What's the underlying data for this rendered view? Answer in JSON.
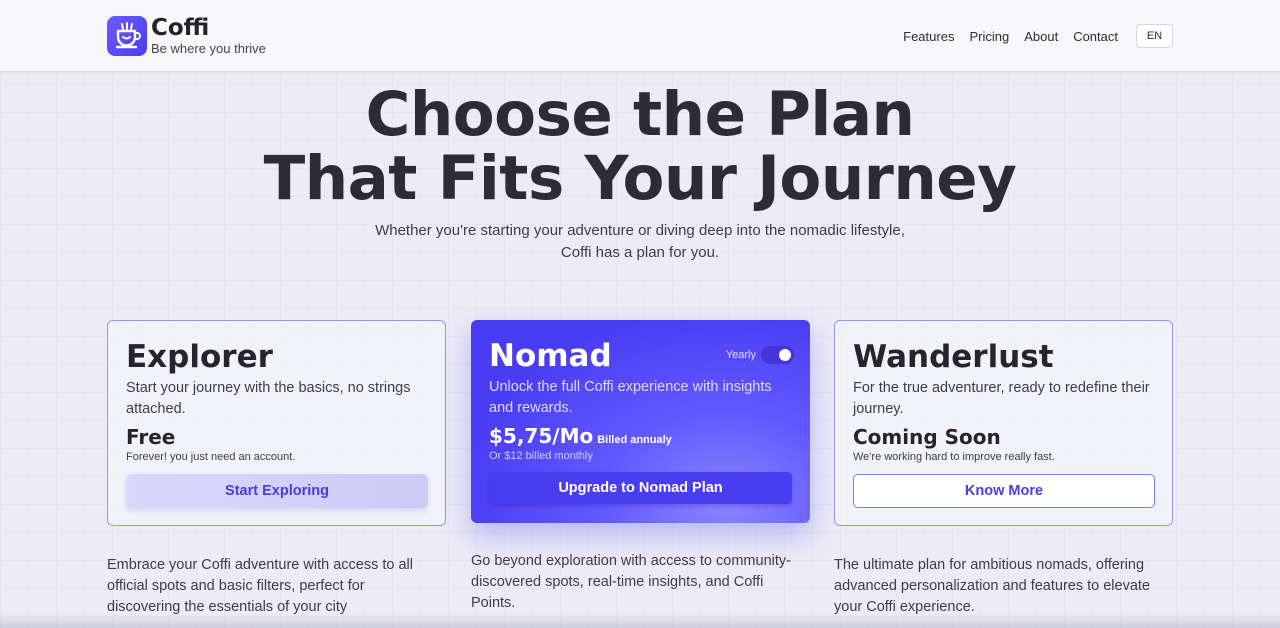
{
  "header": {
    "brand_name": "Coffi",
    "tagline": "Be where you thrive",
    "nav": [
      "Features",
      "Pricing",
      "About",
      "Contact"
    ],
    "language": "EN"
  },
  "hero": {
    "title_line1": "Choose the Plan",
    "title_line2": "That Fits Your Journey",
    "subtitle_line1": "Whether you're starting your adventure or diving deep into the nomadic lifestyle,",
    "subtitle_line2": "Coffi has a plan for you."
  },
  "plans": [
    {
      "name": "Explorer",
      "description": "Start your journey with the basics, no strings attached.",
      "price": "Free",
      "price_note": "Forever! you just need an account.",
      "button": "Start Exploring",
      "details": "Embrace your Coffi adventure with access to all official spots and basic filters, perfect for discovering the essentials of your city"
    },
    {
      "name": "Nomad",
      "toggle_label": "Yearly",
      "toggle_on": true,
      "description": "Unlock the full Coffi experience with insights and rewards.",
      "price": "$5,75/Mo",
      "billing": "Billed annualy",
      "price_note": "Or $12 billed monthly",
      "button": "Upgrade to Nomad Plan",
      "details": "Go beyond exploration with access to community-discovered spots, real-time insights, and Coffi Points."
    },
    {
      "name": "Wanderlust",
      "description": "For the true adventurer, ready to redefine their journey.",
      "price": "Coming Soon",
      "price_note": "We're working hard to improve really fast.",
      "button": "Know More",
      "details": "The ultimate plan for ambitious nomads, offering advanced personalization and features to elevate your Coffi experience."
    }
  ],
  "colors": {
    "accent": "#4a3cf0",
    "background": "#ecebf6",
    "card_border": "#8f9ae8"
  },
  "icons": {
    "logo": "coffee-cup-icon"
  }
}
